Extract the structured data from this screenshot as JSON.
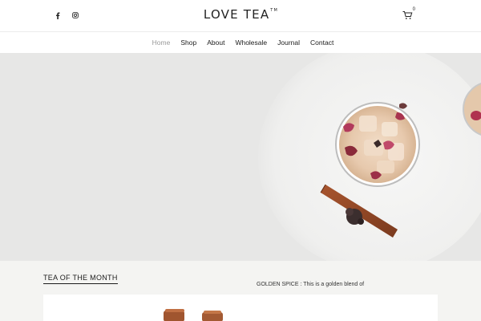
{
  "header": {
    "social": [
      {
        "icon": "facebook-icon"
      },
      {
        "icon": "instagram-icon"
      }
    ],
    "logo_text": "LOVE TEA",
    "logo_mark": "TM",
    "cart_count": "0"
  },
  "nav": {
    "items": [
      {
        "label": "Home",
        "active": true
      },
      {
        "label": "Shop",
        "active": false
      },
      {
        "label": "About",
        "active": false
      },
      {
        "label": "Wholesale",
        "active": false
      },
      {
        "label": "Journal",
        "active": false
      },
      {
        "label": "Contact",
        "active": false
      }
    ]
  },
  "hero": {
    "icons": [
      "iced-tea-glass-image",
      "cinnamon-stick-image",
      "star-anise-image"
    ]
  },
  "feature": {
    "title": "TEA OF THE MONTH",
    "description": "GOLDEN SPICE : This is a golden blend of"
  },
  "colors": {
    "nav_active": "#9a9a9a",
    "hero_bg": "#e8e8e8",
    "section_bg": "#f4f4f2"
  }
}
